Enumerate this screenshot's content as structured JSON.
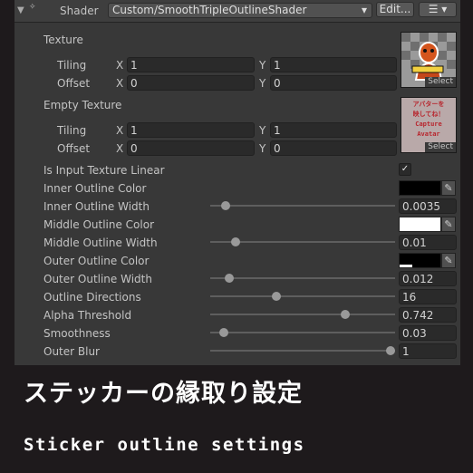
{
  "header": {
    "label": "Shader",
    "shader_name": "Custom/SmoothTripleOutlineShader",
    "edit_label": "Edit...",
    "dropdown_arrow": "▾",
    "list_icon": "☰"
  },
  "texture": {
    "label": "Texture",
    "tiling_label": "Tiling",
    "offset_label": "Offset",
    "x_label": "X",
    "y_label": "Y",
    "tiling_x": "1",
    "tiling_y": "1",
    "offset_x": "0",
    "offset_y": "0",
    "select_label": "Select"
  },
  "empty_texture": {
    "label": "Empty Texture",
    "tiling_label": "Tiling",
    "offset_label": "Offset",
    "x_label": "X",
    "y_label": "Y",
    "tiling_x": "1",
    "tiling_y": "1",
    "offset_x": "0",
    "offset_y": "0",
    "select_label": "Select",
    "thumb_lines": [
      "アバターを",
      "映してね！",
      "Capture",
      "Avatar"
    ]
  },
  "linear": {
    "label": "Is Input Texture Linear",
    "checked": true,
    "check_glyph": "✓"
  },
  "colors": {
    "inner_outline": "#000000",
    "middle_outline": "#ffffff",
    "outer_outline": "#000000"
  },
  "properties": {
    "inner_outline_color_label": "Inner Outline Color",
    "inner_outline_width_label": "Inner Outline Width",
    "inner_outline_width_value": "0.0035",
    "middle_outline_color_label": "Middle Outline Color",
    "middle_outline_width_label": "Middle Outline Width",
    "middle_outline_width_value": "0.01",
    "outer_outline_color_label": "Outer Outline Color",
    "outer_outline_width_label": "Outer Outline Width",
    "outer_outline_width_value": "0.012",
    "outline_directions_label": "Outline Directions",
    "outline_directions_value": "16",
    "alpha_threshold_label": "Alpha Threshold",
    "alpha_threshold_value": "0.742",
    "smoothness_label": "Smoothness",
    "smoothness_value": "0.03",
    "outer_blur_label": "Outer Blur",
    "outer_blur_value": "1"
  },
  "slider_levels": {
    "inner_outline_width": 0.06,
    "middle_outline_width": 0.12,
    "outer_outline_width": 0.08,
    "outline_directions": 0.35,
    "alpha_threshold": 0.74,
    "smoothness": 0.05,
    "outer_blur": 1.0
  },
  "icons": {
    "eyedropper": "✎"
  },
  "caption": {
    "title": "ステッカーの縁取り設定",
    "subtitle": "Sticker outline settings"
  }
}
